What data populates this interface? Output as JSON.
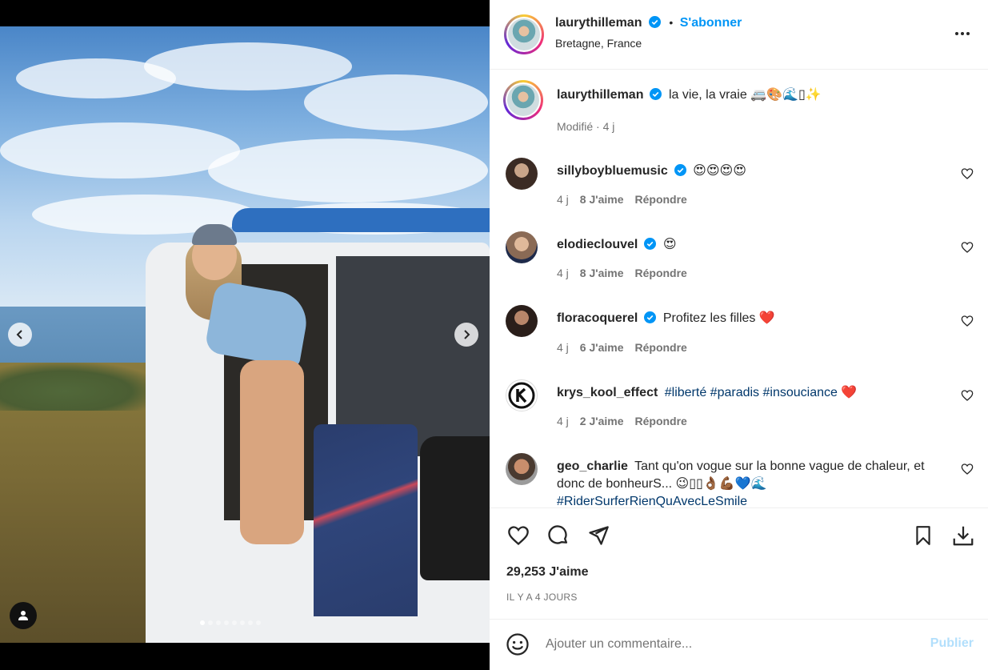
{
  "post": {
    "author": "laurythilleman",
    "follow_label": "S'abonner",
    "location": "Bretagne, France",
    "caption": "la vie, la vraie 🚐🎨🌊▯✨",
    "edited_meta": "Modifié · 4 j",
    "likes": "29,253 J'aime",
    "posted_time": "IL Y A 4 JOURS",
    "media_slide_count": 8,
    "media_active_slide": 1
  },
  "comments": [
    {
      "user": "sillyboybluemusic",
      "text": "😍😍😍😍",
      "age": "4 j",
      "likes": "8 J'aime",
      "reply": "Répondre"
    },
    {
      "user": "elodieclouvel",
      "text": "😍",
      "age": "4 j",
      "likes": "8 J'aime",
      "reply": "Répondre"
    },
    {
      "user": "floracoquerel",
      "text": "Profitez les filles ❤️",
      "age": "4 j",
      "likes": "6 J'aime",
      "reply": "Répondre"
    },
    {
      "user": "krys_kool_effect",
      "text_pre": "",
      "hashtags": "#liberté #paradis #insouciance",
      "text_post": " ❤️",
      "age": "4 j",
      "likes": "2 J'aime",
      "reply": "Répondre"
    },
    {
      "user": "geo_charlie",
      "text": "Tant qu'on vogue sur la bonne vague de chaleur, et donc de bonheurS... 😉▯▯👌🏾💪🏾💙🌊",
      "hashtag": "#RiderSurferRienQuAvecLeSmile"
    }
  ],
  "composer": {
    "placeholder": "Ajouter un commentaire...",
    "publish_label": "Publier"
  },
  "colors": {
    "link_blue": "#0095f6",
    "publish_disabled": "#b2dffc",
    "hashtag": "#00376b",
    "verified": "#0095f6"
  },
  "icons": [
    "more-options-icon",
    "heart-icon",
    "comment-icon",
    "share-icon",
    "bookmark-icon",
    "download-icon",
    "emoji-icon",
    "verified-badge-icon",
    "chevron-left-icon",
    "chevron-right-icon",
    "user-tag-icon"
  ]
}
